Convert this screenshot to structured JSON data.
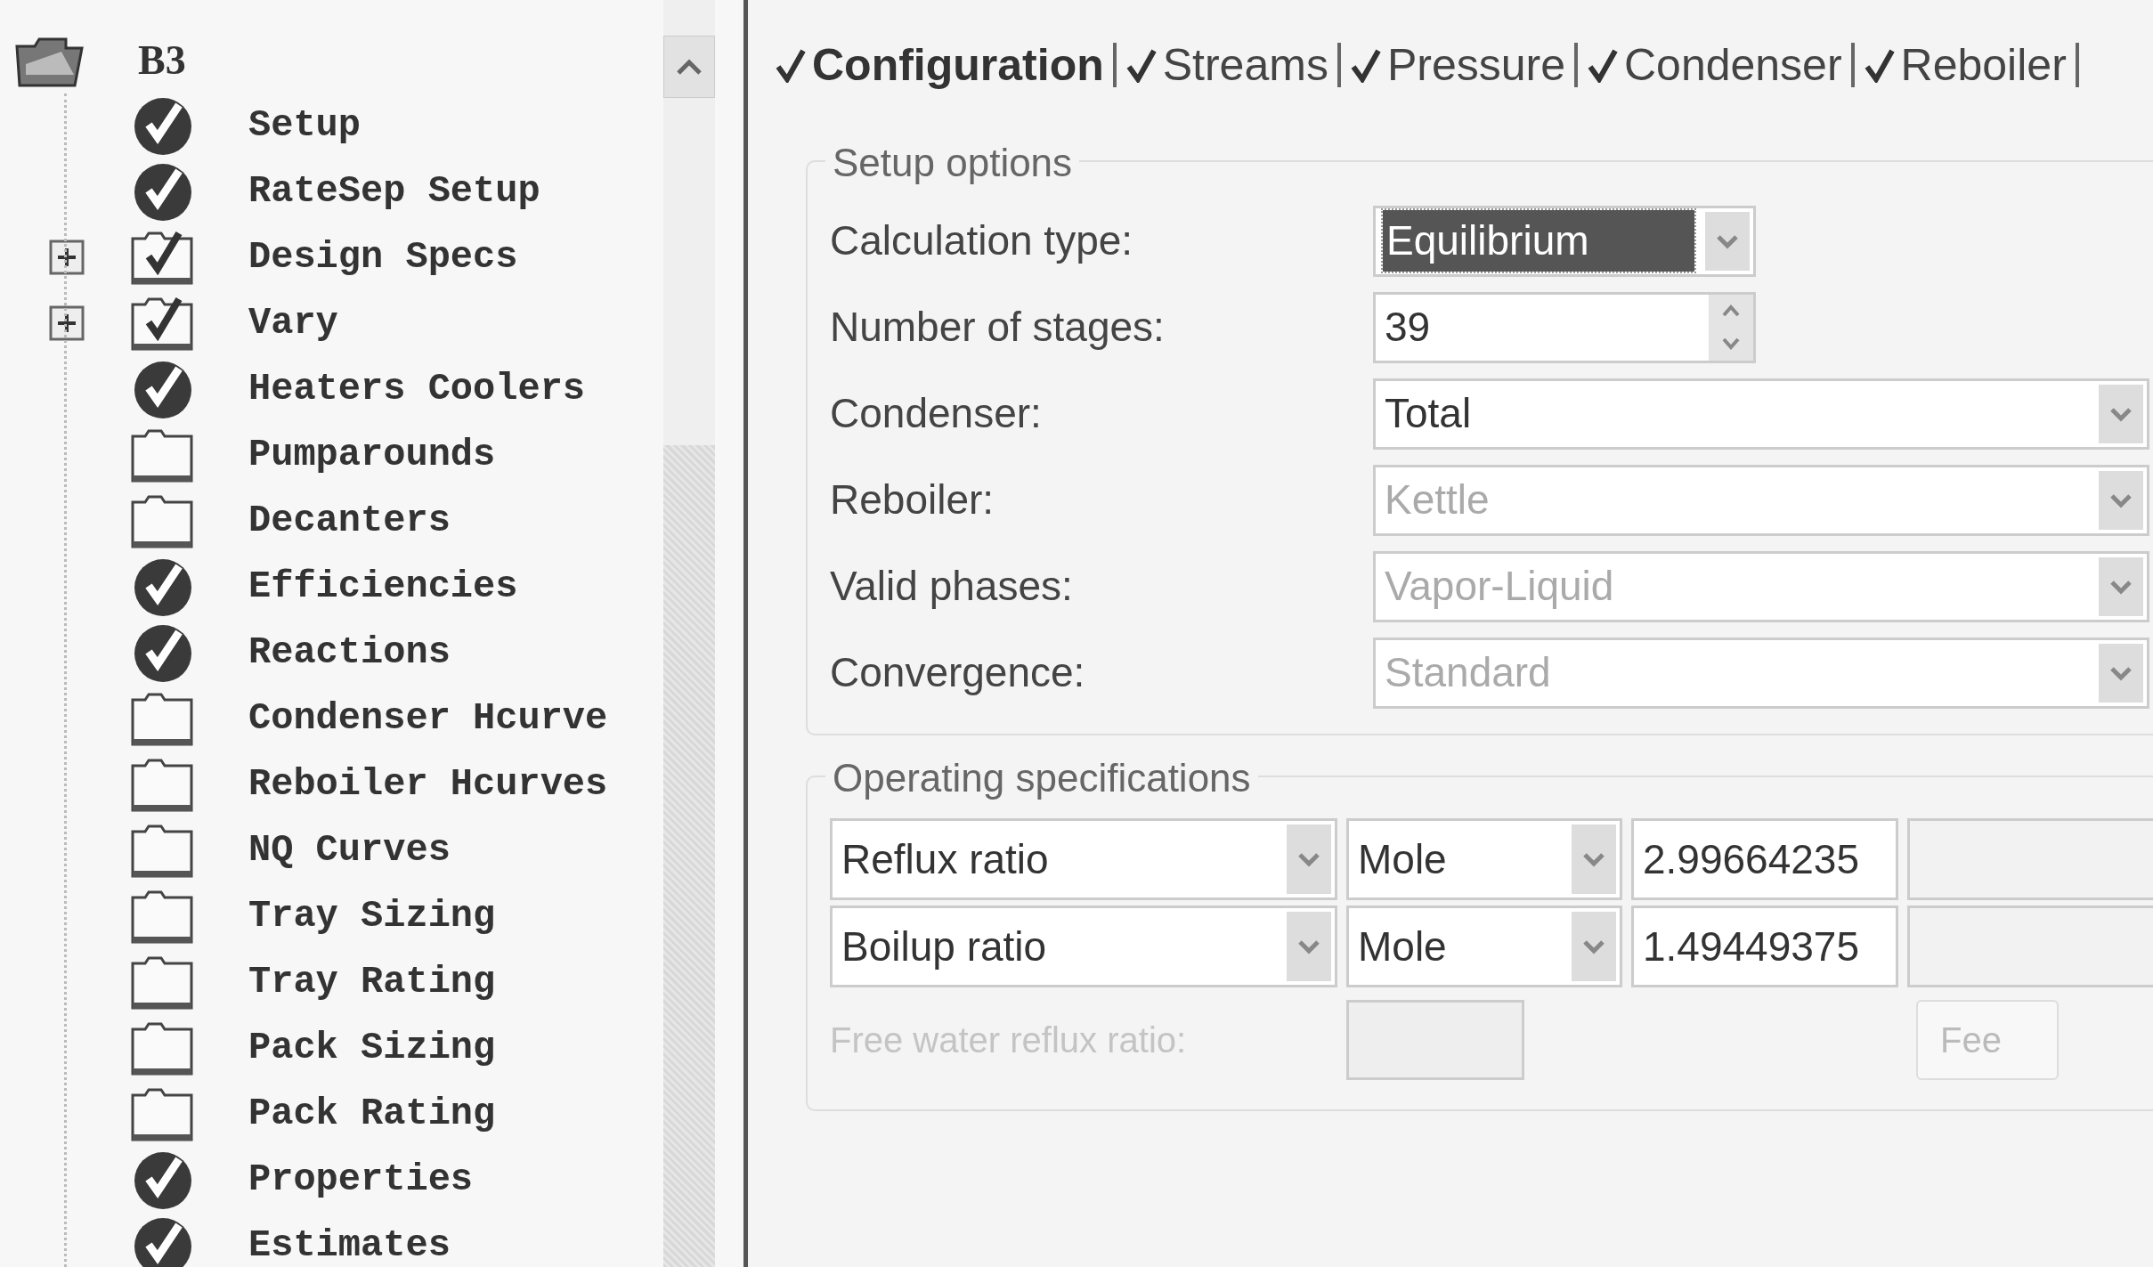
{
  "tree": {
    "root": {
      "label": "B3"
    },
    "items": [
      {
        "label": "Setup",
        "kind": "complete",
        "expandable": false
      },
      {
        "label": "RateSep Setup",
        "kind": "complete",
        "expandable": false
      },
      {
        "label": "Design Specs",
        "kind": "input",
        "expandable": true
      },
      {
        "label": "Vary",
        "kind": "input",
        "expandable": true
      },
      {
        "label": "Heaters Coolers",
        "kind": "complete",
        "expandable": false
      },
      {
        "label": "Pumparounds",
        "kind": "empty",
        "expandable": false
      },
      {
        "label": "Decanters",
        "kind": "empty",
        "expandable": false
      },
      {
        "label": "Efficiencies",
        "kind": "complete",
        "expandable": false
      },
      {
        "label": "Reactions",
        "kind": "complete",
        "expandable": false
      },
      {
        "label": "Condenser Hcurve",
        "kind": "empty",
        "expandable": false
      },
      {
        "label": "Reboiler Hcurves",
        "kind": "empty",
        "expandable": false
      },
      {
        "label": "NQ Curves",
        "kind": "empty",
        "expandable": false
      },
      {
        "label": "Tray Sizing",
        "kind": "empty",
        "expandable": false
      },
      {
        "label": "Tray Rating",
        "kind": "empty",
        "expandable": false
      },
      {
        "label": "Pack Sizing",
        "kind": "empty",
        "expandable": false
      },
      {
        "label": "Pack Rating",
        "kind": "empty",
        "expandable": false
      },
      {
        "label": "Properties",
        "kind": "complete",
        "expandable": false
      },
      {
        "label": "Estimates",
        "kind": "complete",
        "expandable": false
      }
    ]
  },
  "tabs": [
    {
      "label": "Configuration",
      "selected": true,
      "complete": true
    },
    {
      "label": "Streams",
      "selected": false,
      "complete": true
    },
    {
      "label": "Pressure",
      "selected": false,
      "complete": true
    },
    {
      "label": "Condenser",
      "selected": false,
      "complete": true
    },
    {
      "label": "Reboiler",
      "selected": false,
      "complete": true
    }
  ],
  "setup_options": {
    "title": "Setup options",
    "fields": [
      {
        "label": "Calculation type:",
        "value": "Equilibrium",
        "kind": "dropdown",
        "disabled": false,
        "focused": true
      },
      {
        "label": "Number of stages:",
        "value": "39",
        "kind": "spinner",
        "disabled": false,
        "focused": false
      },
      {
        "label": "Condenser:",
        "value": "Total",
        "kind": "wide-dropdown",
        "disabled": false,
        "focused": false
      },
      {
        "label": "Reboiler:",
        "value": "Kettle",
        "kind": "wide-dropdown",
        "disabled": true,
        "focused": false
      },
      {
        "label": "Valid phases:",
        "value": "Vapor-Liquid",
        "kind": "wide-dropdown",
        "disabled": true,
        "focused": false
      },
      {
        "label": "Convergence:",
        "value": "Standard",
        "kind": "wide-dropdown",
        "disabled": true,
        "focused": false
      }
    ]
  },
  "operating_specifications": {
    "title": "Operating specifications",
    "rows": [
      {
        "spec": "Reflux ratio",
        "basis": "Mole",
        "value": "2.99664235"
      },
      {
        "spec": "Boilup ratio",
        "basis": "Mole",
        "value": "1.49449375"
      }
    ],
    "free_water": {
      "label": "Free water reflux ratio:",
      "disabled": true
    },
    "feed_button": {
      "label": "Fee",
      "disabled": true
    }
  }
}
